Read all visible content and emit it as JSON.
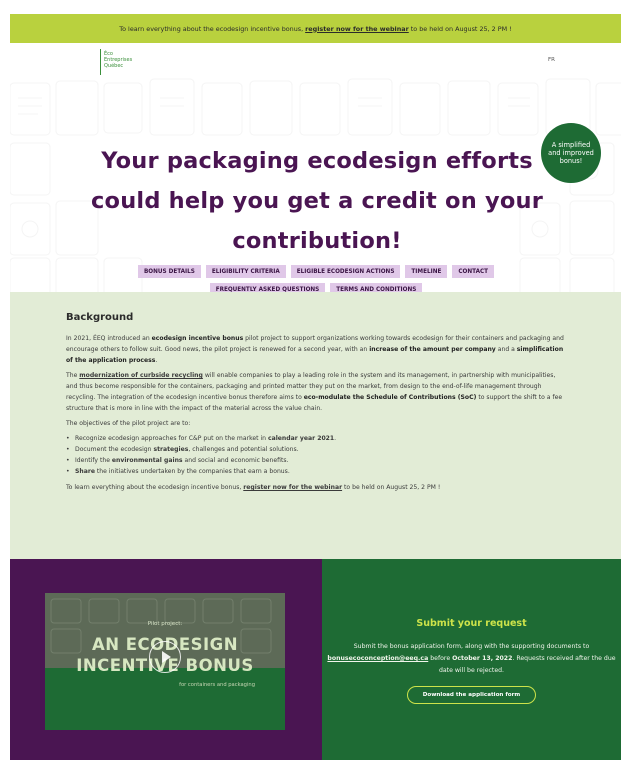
{
  "banner": {
    "pre": "To learn everything about the ecodesign incentive bonus,",
    "link": "register now for the webinar",
    "post": "to be held on August 25, 2 PM !"
  },
  "logo": {
    "line1": "Éco",
    "line2": "Entreprises",
    "line3": "Québec"
  },
  "lang_toggle": "FR",
  "badge": "A simplified and improved bonus!",
  "hero_title": "Your packaging ecodesign efforts could help you get a credit on your contribution!",
  "nav": [
    "BONUS DETAILS",
    "ELIGIBILITY CRITERIA",
    "ELIGIBLE ECODESIGN ACTIONS",
    "TIMELINE",
    "CONTACT",
    "FREQUENTLY ASKED QUESTIONS",
    "TERMS AND CONDITIONS"
  ],
  "background": {
    "title": "Background",
    "p1": {
      "a": "In 2021, ÉEQ introduced an",
      "b": "ecodesign incentive bonus",
      "c": "pilot project to support organizations working towards ecodesign for their containers and packaging and encourage others to follow suit. Good news, the pilot project is renewed for a second year, with an",
      "d": "increase of the amount per company",
      "e": "and a",
      "f": "simplification of the application process",
      "g": "."
    },
    "p2": {
      "a": "The",
      "b": "modernization of curbside recycling",
      "c": "will enable companies to play a leading role in the system and its management, in partnership with municipalities, and thus become responsible for the containers, packaging and printed matter they put on the market, from design to the end-of-life management through recycling. The integration of the ecodesign incentive bonus therefore aims to",
      "d": "eco-modulate the Schedule of Contributions (SoC)",
      "e": "to support the shift to a fee structure that is more in line with the impact of the material across the value chain."
    },
    "p3": "The objectives of the pilot project are to:",
    "objectives": [
      {
        "a": "Recognize ecodesign approaches for C&P put on the market in",
        "b": "calendar year 2021",
        "c": "."
      },
      {
        "a": "Document the ecodesign",
        "b": "strategies",
        "c": ", challenges and potential solutions."
      },
      {
        "a": "Identify the",
        "b": "environmental gains",
        "c": "and social and economic benefits."
      },
      {
        "a": "",
        "b": "Share",
        "c": "the initiatives undertaken by the companies that earn a bonus."
      }
    ],
    "p4": {
      "a": "To learn everything about the ecodesign incentive bonus,",
      "b": "register now for the webinar",
      "c": "to be held on August 25, 2 PM !"
    }
  },
  "video": {
    "pre": "Pilot project:",
    "title_line1": "AN ECODESIGN",
    "title_line2": "INCENTIVE BONUS",
    "subtitle": "for containers and packaging"
  },
  "submit": {
    "title": "Submit your request",
    "text_a": "Submit the bonus application form, along with the supporting documents to",
    "email": "bonusecoconception@eeq.ca",
    "text_b": "before",
    "deadline": "October 13, 2022",
    "text_c": ". Requests received after the due date will be rejected.",
    "button": "Download the application form"
  },
  "colors": {
    "banner": "#b9d13e",
    "title_purple": "#4a1552",
    "nav_bg": "#e0c8e8",
    "section_bg": "#e2ecd6",
    "green": "#1e6b34",
    "accent_yellow": "#cde34a"
  }
}
